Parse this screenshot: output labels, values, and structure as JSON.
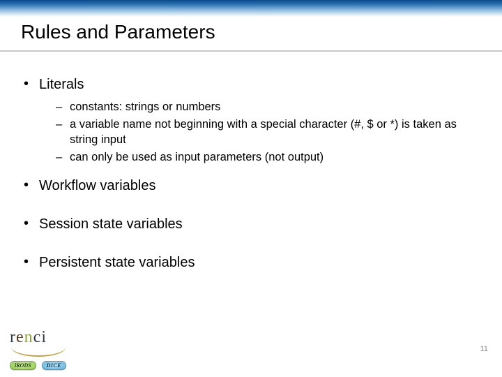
{
  "title": "Rules and Parameters",
  "bullets": {
    "b0": {
      "label": "Literals",
      "sub": [
        "constants: strings or numbers",
        "a variable name not beginning with a special character (#, $ or *) is taken as string input",
        "can only be used as input parameters (not output)"
      ]
    },
    "b1": {
      "label": "Workflow variables"
    },
    "b2": {
      "label": "Session state variables"
    },
    "b3": {
      "label": "Persistent state variables"
    }
  },
  "footer": {
    "logo_text": "renci",
    "tag1": "iRODS",
    "tag2": "DICE"
  },
  "page_number": "11"
}
